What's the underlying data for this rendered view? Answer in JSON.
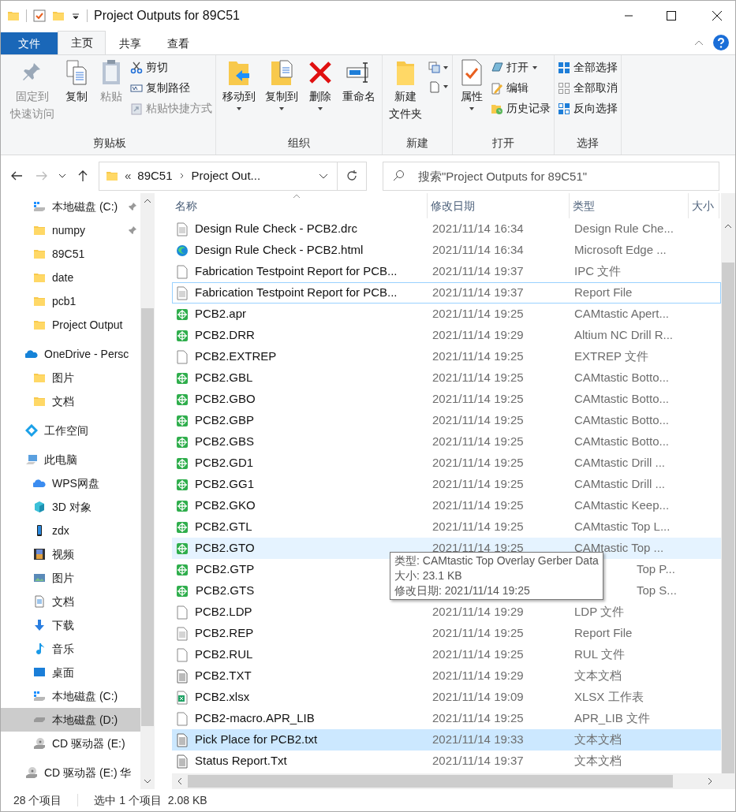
{
  "window": {
    "title": "Project Outputs for 89C51"
  },
  "ribbon_tabs": [
    {
      "label": "文件",
      "kind": "file",
      "selected": false
    },
    {
      "label": "主页",
      "kind": "tab",
      "selected": true
    },
    {
      "label": "共享",
      "kind": "tab",
      "selected": false
    },
    {
      "label": "查看",
      "kind": "tab",
      "selected": false
    }
  ],
  "ribbon_groups": [
    {
      "name": "剪贴板",
      "items": [
        {
          "kind": "large",
          "label": "固定到",
          "label2": "快速访问",
          "caret": false,
          "disabled": true
        },
        {
          "kind": "large",
          "label": "复制",
          "caret": false,
          "disabled": false
        },
        {
          "kind": "large",
          "label": "粘贴",
          "caret": false,
          "disabled": true
        },
        {
          "kind": "stack",
          "entries": [
            {
              "label": "剪切",
              "caret": false,
              "disabled": false
            },
            {
              "label": "复制路径",
              "caret": false,
              "disabled": false
            },
            {
              "label": "粘贴快捷方式",
              "caret": false,
              "disabled": true
            }
          ]
        }
      ]
    },
    {
      "name": "组织",
      "items": [
        {
          "kind": "large",
          "label": "移动到",
          "caret": true,
          "disabled": false
        },
        {
          "kind": "large",
          "label": "复制到",
          "caret": true,
          "disabled": false
        },
        {
          "kind": "large",
          "label": "删除",
          "caret": true,
          "disabled": false
        },
        {
          "kind": "large",
          "label": "重命名",
          "caret": false,
          "disabled": false
        }
      ]
    },
    {
      "name": "新建",
      "items": [
        {
          "kind": "large",
          "label": "新建",
          "label2": "文件夹",
          "caret": false,
          "disabled": false
        },
        {
          "kind": "smallicons"
        }
      ]
    },
    {
      "name": "打开",
      "items": [
        {
          "kind": "large",
          "label": "属性",
          "caret": true,
          "disabled": false
        },
        {
          "kind": "stack",
          "entries": [
            {
              "label": "打开",
              "caret": true,
              "disabled": false
            },
            {
              "label": "编辑",
              "caret": false,
              "disabled": false
            },
            {
              "label": "历史记录",
              "caret": false,
              "disabled": false
            }
          ]
        }
      ]
    },
    {
      "name": "选择",
      "items": [
        {
          "kind": "stack",
          "entries": [
            {
              "label": "全部选择",
              "caret": false,
              "disabled": false
            },
            {
              "label": "全部取消",
              "caret": false,
              "disabled": false
            },
            {
              "label": "反向选择",
              "caret": false,
              "disabled": false
            }
          ]
        }
      ]
    }
  ],
  "address": {
    "overflow": "«",
    "crumbs": [
      "89C51",
      "Project Out..."
    ]
  },
  "search": {
    "placeholder": "搜索\"Project Outputs for 89C51\""
  },
  "sidebar": [
    {
      "children": [
        {
          "label": "本地磁盘 (C:)",
          "kind": "drivec",
          "pinned": true,
          "selected": false
        },
        {
          "label": "numpy",
          "kind": "folder",
          "pinned": true,
          "selected": false
        },
        {
          "label": "89C51",
          "kind": "folder",
          "pinned": false,
          "selected": false
        },
        {
          "label": "date",
          "kind": "folder",
          "pinned": false,
          "selected": false
        },
        {
          "label": "pcb1",
          "kind": "folder",
          "pinned": false,
          "selected": false
        },
        {
          "label": "Project Output",
          "kind": "folder",
          "pinned": false,
          "selected": false
        }
      ]
    },
    {
      "label": "OneDrive - Persc",
      "kind": "onedrive",
      "pinned": false,
      "selected": false,
      "children": [
        {
          "label": "图片",
          "kind": "folder",
          "pinned": false,
          "selected": false
        },
        {
          "label": "文档",
          "kind": "folder",
          "pinned": false,
          "selected": false
        }
      ]
    },
    {
      "label": "工作空间",
      "kind": "workspace",
      "pinned": false,
      "selected": false
    },
    {
      "label": "此电脑",
      "kind": "pc",
      "pinned": false,
      "selected": false,
      "children": [
        {
          "label": "WPS网盘",
          "kind": "wps",
          "pinned": false,
          "selected": false
        },
        {
          "label": "3D 对象",
          "kind": "cube",
          "pinned": false,
          "selected": false
        },
        {
          "label": "zdx",
          "kind": "phone",
          "pinned": false,
          "selected": false
        },
        {
          "label": "视频",
          "kind": "video",
          "pinned": false,
          "selected": false
        },
        {
          "label": "图片",
          "kind": "pictures",
          "pinned": false,
          "selected": false
        },
        {
          "label": "文档",
          "kind": "docs",
          "pinned": false,
          "selected": false
        },
        {
          "label": "下载",
          "kind": "download",
          "pinned": false,
          "selected": false
        },
        {
          "label": "音乐",
          "kind": "music",
          "pinned": false,
          "selected": false
        },
        {
          "label": "桌面",
          "kind": "desktop",
          "pinned": false,
          "selected": false
        },
        {
          "label": "本地磁盘 (C:)",
          "kind": "drivec",
          "pinned": false,
          "selected": false
        },
        {
          "label": "本地磁盘 (D:)",
          "kind": "drive",
          "pinned": false,
          "selected": true
        },
        {
          "label": "CD 驱动器 (E:)",
          "kind": "cd",
          "pinned": false,
          "selected": false
        }
      ]
    },
    {
      "label": "CD 驱动器 (E:) 华",
      "kind": "cd",
      "pinned": false,
      "selected": false
    }
  ],
  "columns": [
    "名称",
    "修改日期",
    "类型",
    "大小"
  ],
  "files": [
    {
      "name": "Design Rule Check - PCB2.drc",
      "date": "2021/11/14 16:34",
      "type": "Design Rule Che...",
      "kind": "doc",
      "selected": false,
      "hovered": false,
      "focused": false
    },
    {
      "name": "Design Rule Check - PCB2.html",
      "date": "2021/11/14 16:34",
      "type": "Microsoft Edge ...",
      "kind": "edge",
      "selected": false,
      "hovered": false,
      "focused": false
    },
    {
      "name": "Fabrication Testpoint Report for PCB...",
      "date": "2021/11/14 19:37",
      "type": "IPC 文件",
      "kind": "blank",
      "selected": false,
      "hovered": false,
      "focused": false
    },
    {
      "name": "Fabrication Testpoint Report for PCB...",
      "date": "2021/11/14 19:37",
      "type": "Report File",
      "kind": "doc",
      "selected": false,
      "hovered": false,
      "focused": true
    },
    {
      "name": "PCB2.apr",
      "date": "2021/11/14 19:25",
      "type": "CAMtastic Apert...",
      "kind": "gerber",
      "selected": false,
      "hovered": false,
      "focused": false
    },
    {
      "name": "PCB2.DRR",
      "date": "2021/11/14 19:29",
      "type": "Altium NC Drill R...",
      "kind": "gerber",
      "selected": false,
      "hovered": false,
      "focused": false
    },
    {
      "name": "PCB2.EXTREP",
      "date": "2021/11/14 19:25",
      "type": "EXTREP 文件",
      "kind": "blank",
      "selected": false,
      "hovered": false,
      "focused": false
    },
    {
      "name": "PCB2.GBL",
      "date": "2021/11/14 19:25",
      "type": "CAMtastic Botto...",
      "kind": "gerber",
      "selected": false,
      "hovered": false,
      "focused": false
    },
    {
      "name": "PCB2.GBO",
      "date": "2021/11/14 19:25",
      "type": "CAMtastic Botto...",
      "kind": "gerber",
      "selected": false,
      "hovered": false,
      "focused": false
    },
    {
      "name": "PCB2.GBP",
      "date": "2021/11/14 19:25",
      "type": "CAMtastic Botto...",
      "kind": "gerber",
      "selected": false,
      "hovered": false,
      "focused": false
    },
    {
      "name": "PCB2.GBS",
      "date": "2021/11/14 19:25",
      "type": "CAMtastic Botto...",
      "kind": "gerber",
      "selected": false,
      "hovered": false,
      "focused": false
    },
    {
      "name": "PCB2.GD1",
      "date": "2021/11/14 19:25",
      "type": "CAMtastic Drill ...",
      "kind": "gerber",
      "selected": false,
      "hovered": false,
      "focused": false
    },
    {
      "name": "PCB2.GG1",
      "date": "2021/11/14 19:25",
      "type": "CAMtastic Drill ...",
      "kind": "gerber",
      "selected": false,
      "hovered": false,
      "focused": false
    },
    {
      "name": "PCB2.GKO",
      "date": "2021/11/14 19:25",
      "type": "CAMtastic Keep...",
      "kind": "gerber",
      "selected": false,
      "hovered": false,
      "focused": false
    },
    {
      "name": "PCB2.GTL",
      "date": "2021/11/14 19:25",
      "type": "CAMtastic Top L...",
      "kind": "gerber",
      "selected": false,
      "hovered": false,
      "focused": false
    },
    {
      "name": "PCB2.GTO",
      "date": "2021/11/14 19:25",
      "type": "CAMtastic Top ...",
      "kind": "gerber",
      "selected": false,
      "hovered": true,
      "focused": false
    },
    {
      "name": "PCB2.GTP",
      "type": "Top P...",
      "kind": "gerber",
      "selected": false,
      "hovered": false,
      "focused": false
    },
    {
      "name": "PCB2.GTS",
      "type": "Top S...",
      "kind": "gerber",
      "selected": false,
      "hovered": false,
      "focused": false
    },
    {
      "name": "PCB2.LDP",
      "date": "2021/11/14 19:29",
      "type": "LDP 文件",
      "kind": "blank",
      "selected": false,
      "hovered": false,
      "focused": false
    },
    {
      "name": "PCB2.REP",
      "date": "2021/11/14 19:25",
      "type": "Report File",
      "kind": "doc",
      "selected": false,
      "hovered": false,
      "focused": false
    },
    {
      "name": "PCB2.RUL",
      "date": "2021/11/14 19:25",
      "type": "RUL 文件",
      "kind": "blank",
      "selected": false,
      "hovered": false,
      "focused": false
    },
    {
      "name": "PCB2.TXT",
      "date": "2021/11/14 19:29",
      "type": "文本文档",
      "kind": "txt",
      "selected": false,
      "hovered": false,
      "focused": false
    },
    {
      "name": "PCB2.xlsx",
      "date": "2021/11/14 19:09",
      "type": "XLSX 工作表",
      "kind": "xlsx",
      "selected": false,
      "hovered": false,
      "focused": false
    },
    {
      "name": "PCB2-macro.APR_LIB",
      "date": "2021/11/14 19:25",
      "type": "APR_LIB 文件",
      "kind": "blank",
      "selected": false,
      "hovered": false,
      "focused": false
    },
    {
      "name": "Pick Place for PCB2.txt",
      "date": "2021/11/14 19:33",
      "type": "文本文档",
      "kind": "txt",
      "selected": true,
      "hovered": false,
      "focused": false
    },
    {
      "name": "Status Report.Txt",
      "date": "2021/11/14 19:37",
      "type": "文本文档",
      "kind": "txt",
      "selected": false,
      "hovered": false,
      "focused": false
    }
  ],
  "tooltip": [
    "类型: CAMtastic Top Overlay Gerber Data",
    "大小: 23.1 KB",
    "修改日期: 2021/11/14 19:25"
  ],
  "status_bar": {
    "count": "28 个项目",
    "selection": "选中 1 个项目  2.08 KB"
  }
}
